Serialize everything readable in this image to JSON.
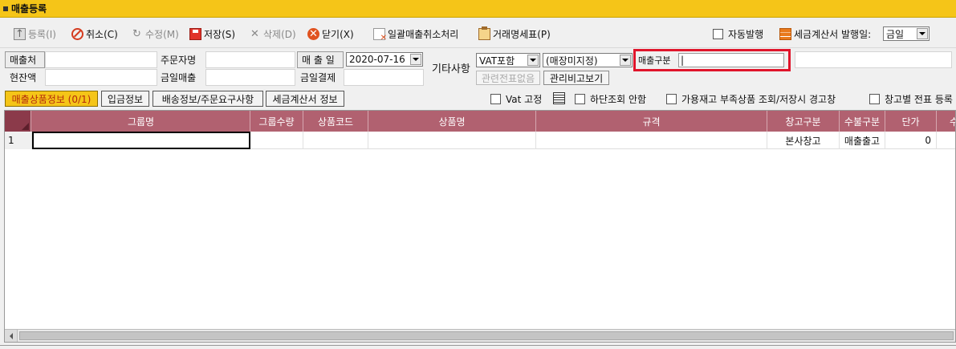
{
  "window": {
    "title": "매출등록"
  },
  "toolbar": {
    "register": "등록(I)",
    "cancel": "취소(C)",
    "edit": "수정(M)",
    "save": "저장(S)",
    "delete": "삭제(D)",
    "close": "닫기(X)",
    "bulk_cancel": "일괄매출취소처리",
    "statement": "거래명세표(P)",
    "auto_issue": "자동발행",
    "tax_invoice_date_label": "세금계산서 발행일:",
    "tax_invoice_date_value": "금일"
  },
  "form": {
    "customer_label": "매출처",
    "orderer_label": "주문자명",
    "sales_date_label": "매 출 일",
    "sales_date_value": "2020-07-16",
    "cash_label": "현잔액",
    "today_sales_label": "금일매출",
    "today_settle_label": "금일결제",
    "misc_label": "기타사항",
    "vat_value": "VAT포함",
    "store_value": "(매장미지정)",
    "sales_type_label": "매출구분",
    "sales_type_value": "|",
    "related_slip_button": "관련전표없음",
    "memo_button": "관리비고보기"
  },
  "tabs": [
    {
      "label": "매출상품정보 (0/1)",
      "selected": true
    },
    {
      "label": "입금정보",
      "selected": false
    },
    {
      "label": "배송정보/주문요구사항",
      "selected": false
    },
    {
      "label": "세금계산서 정보",
      "selected": false
    }
  ],
  "options": {
    "vat_fixed": "Vat 고정",
    "no_bottom_query": "하단조회 안함",
    "stock_warning": "가용재고 부족상품 조회/저장시 경고창",
    "warehouse_slip": "창고별 전표 등록"
  },
  "table": {
    "headers": [
      "그룹명",
      "그룹수량",
      "상품코드",
      "상품명",
      "규격",
      "창고구분",
      "수불구분",
      "단가",
      "수"
    ],
    "rows": [
      {
        "num": "1",
        "group": "",
        "group_qty": "",
        "code": "",
        "name": "",
        "spec": "",
        "warehouse": "본사창고",
        "movement": "매출출고",
        "price": "0"
      }
    ]
  },
  "colors": {
    "title_bar": "#f5c518",
    "header_bg": "#b16170",
    "highlight": "#e0152b"
  }
}
